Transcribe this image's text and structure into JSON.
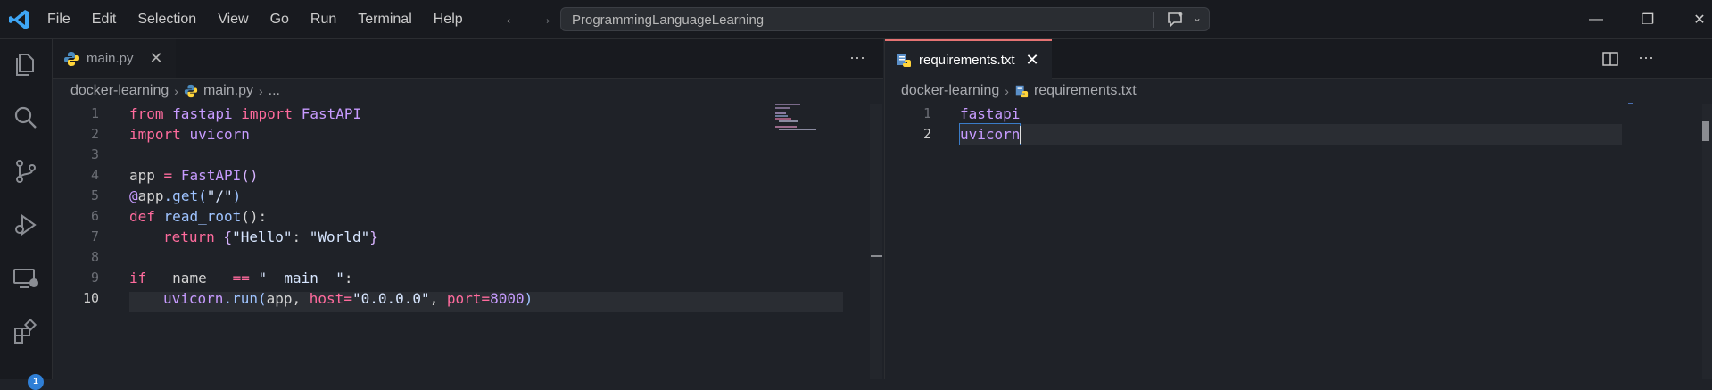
{
  "menu": [
    "File",
    "Edit",
    "Selection",
    "View",
    "Go",
    "Run",
    "Terminal",
    "Help"
  ],
  "search": {
    "text": "ProgrammingLanguageLearning"
  },
  "window_controls": {
    "minimize": "—",
    "restore": "❐",
    "close": "✕"
  },
  "activity": {
    "extensions_badge": "1"
  },
  "left_editor": {
    "tab": {
      "label": "main.py",
      "close": "✕"
    },
    "more": "···",
    "breadcrumb": {
      "folder": "docker-learning",
      "file": "main.py",
      "more": "..."
    },
    "lines": [
      {
        "n": "1"
      },
      {
        "n": "2"
      },
      {
        "n": "3"
      },
      {
        "n": "4"
      },
      {
        "n": "5"
      },
      {
        "n": "6"
      },
      {
        "n": "7"
      },
      {
        "n": "8"
      },
      {
        "n": "9"
      },
      {
        "n": "10"
      }
    ],
    "code": {
      "l1": [
        "from",
        "fastapi",
        "import",
        "FastAPI"
      ],
      "l2": [
        "import",
        "uvicorn"
      ],
      "l4": [
        "app",
        " = ",
        "FastAPI",
        "()"
      ],
      "l5": [
        "@",
        "app",
        ".get(",
        "\"/\"",
        ")"
      ],
      "l6": [
        "def",
        "read_root",
        "():"
      ],
      "l7": [
        "return",
        "{",
        "\"Hello\"",
        ": ",
        "\"World\"",
        "}"
      ],
      "l9": [
        "if",
        "__name__",
        " == ",
        "\"__main__\"",
        ":"
      ],
      "l10": [
        "uvicorn",
        ".run(",
        "app",
        ", ",
        "host",
        "=",
        "\"0.0.0.0\"",
        ", ",
        "port",
        "=",
        "8000",
        ")"
      ]
    }
  },
  "right_editor": {
    "tab": {
      "label": "requirements.txt",
      "close": "✕"
    },
    "breadcrumb": {
      "folder": "docker-learning",
      "file": "requirements.txt"
    },
    "lines": [
      {
        "n": "1",
        "text": "fastapi"
      },
      {
        "n": "2",
        "text": "uvicorn"
      }
    ]
  },
  "colors": {
    "keyword": "#ff6b9d",
    "function": "#9ec3ff",
    "class": "#c79bff",
    "accent": "#2f7fd6"
  }
}
